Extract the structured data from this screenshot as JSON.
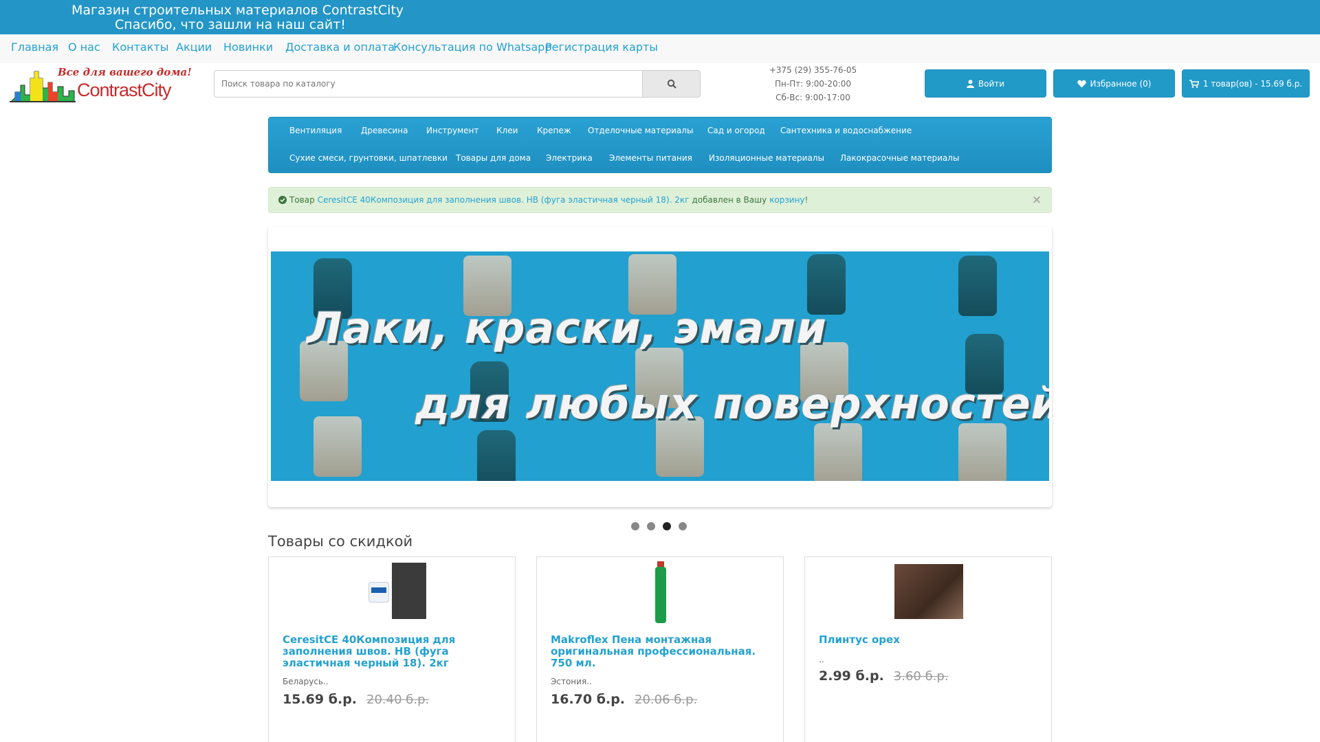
{
  "topbar": {
    "line1": "Магазин строительных материалов ContrastCity",
    "line2": "Спасибо, что зашли на наш сайт!"
  },
  "nav": {
    "links": [
      "Главная",
      "О нас",
      "Контакты",
      "Акции",
      "Новинки",
      "Доставка и оплата",
      "Консультация по Whatsapp",
      "Регистрация карты"
    ]
  },
  "logo": {
    "slogan": "Все для вашего дома!",
    "name": "ContrastCity"
  },
  "search": {
    "placeholder": "Поиск товара по каталогу",
    "icon": "search-icon"
  },
  "contact": {
    "phone": "+375 (29) 355-76-05",
    "hours_weekdays": "Пн-Пт: 9:00-20:00",
    "hours_weekend": "Сб-Вс: 9:00-17:00"
  },
  "header_buttons": {
    "login": "Войти",
    "wishlist": "Избранное (0)",
    "cart": "1 товар(ов) - 15.69 б.р."
  },
  "categories": {
    "row1": [
      "Вентиляция",
      "Древесина",
      "Инструмент",
      "Клеи",
      "Крепеж",
      "Отделочные материалы",
      "Сад и огород",
      "Сантехника и водоснабжение"
    ],
    "row2": [
      "Сухие смеси, грунтовки, шпатлевки",
      "Товары для дома",
      "Электрика",
      "Элементы питания",
      "Изоляционные материалы",
      "Лакокрасочные материалы"
    ]
  },
  "alert": {
    "prefix": "Товар",
    "product": "CeresitCE 40Композиция для заполнения швов. НВ (фуга эластичная черный 18). 2кг",
    "middle": "добавлен в Вашу",
    "cart_link": "корзину",
    "suffix": "!",
    "close": "×"
  },
  "banner": {
    "line1": "Лаки, краски, эмали",
    "line2": "для любых поверхностей",
    "slide_count": 4,
    "active_slide": 3
  },
  "section_title": "Товары со скидкой",
  "products": [
    {
      "title": "CeresitCE 40Композиция для заполнения швов. НВ (фуга эластичная черный 18). 2кг",
      "desc": "Беларусь..",
      "price": "15.69 б.р.",
      "old_price": "20.40 б.р."
    },
    {
      "title": "Makroflex Пена монтажная оригинальная профессиональная. 750 мл.",
      "desc": "Эстония..",
      "price": "16.70 б.р.",
      "old_price": "20.06 б.р."
    },
    {
      "title": "Плинтус орех",
      "desc": "..",
      "price": "2.99 б.р.",
      "old_price": "3.60 б.р."
    }
  ],
  "colors": {
    "primary": "#229ac8",
    "link": "#23a1d1",
    "alert_bg": "#dff0d8",
    "banner_bg": "#22a0cf"
  }
}
